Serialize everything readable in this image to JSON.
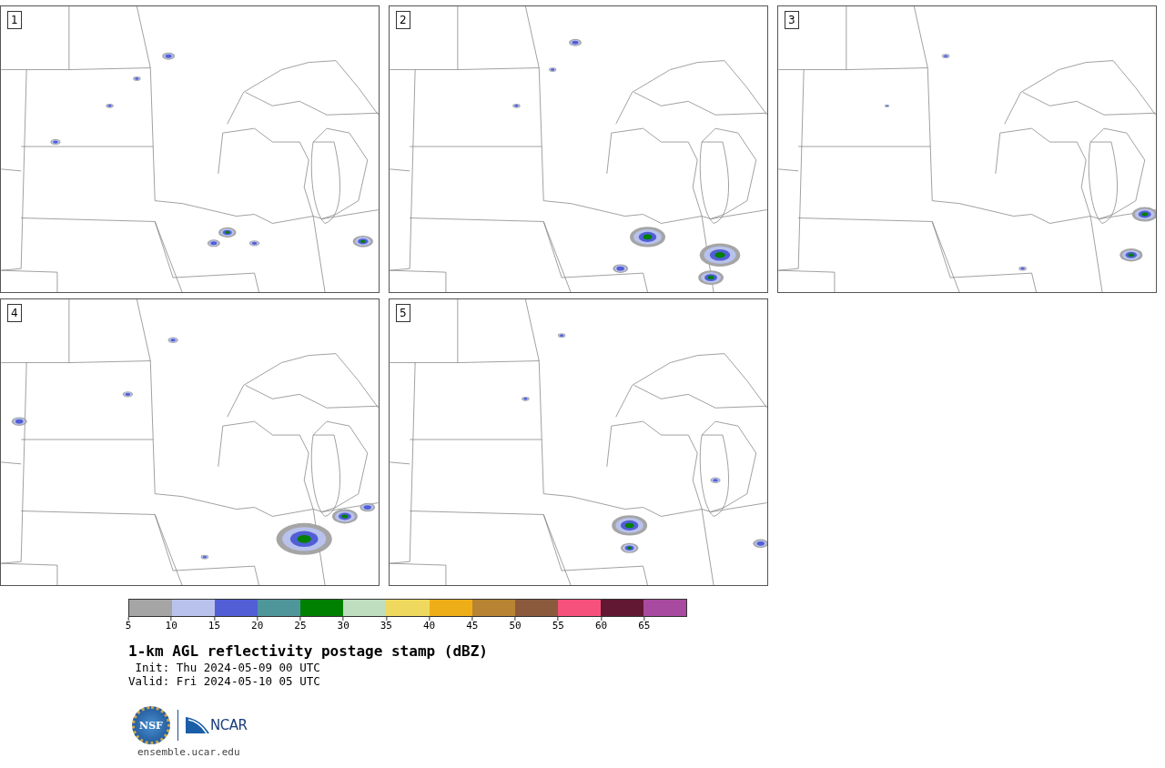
{
  "panels": [
    {
      "label": "1"
    },
    {
      "label": "2"
    },
    {
      "label": "3"
    },
    {
      "label": "4"
    },
    {
      "label": "5"
    }
  ],
  "colorbar": {
    "bins": [
      {
        "color": "#a5a5a5"
      },
      {
        "color": "#b8c2ec"
      },
      {
        "color": "#525ed6"
      },
      {
        "color": "#4f969b"
      },
      {
        "color": "#008000"
      },
      {
        "color": "#bfddbf"
      },
      {
        "color": "#efd85e"
      },
      {
        "color": "#eeae18"
      },
      {
        "color": "#b88332"
      },
      {
        "color": "#8b5a3d"
      },
      {
        "color": "#f5517c"
      },
      {
        "color": "#621733"
      },
      {
        "color": "#a84aa0"
      }
    ],
    "ticks": [
      "5",
      "10",
      "15",
      "20",
      "25",
      "30",
      "35",
      "40",
      "45",
      "50",
      "55",
      "60",
      "65"
    ]
  },
  "title": "1-km AGL reflectivity postage stamp (dBZ)",
  "init": " Init: Thu 2024-05-09 00 UTC",
  "valid": "Valid: Fri 2024-05-10 05 UTC",
  "logos": {
    "nsf": "NSF",
    "ncar": "NCAR"
  },
  "url": "ensemble.ucar.edu"
}
